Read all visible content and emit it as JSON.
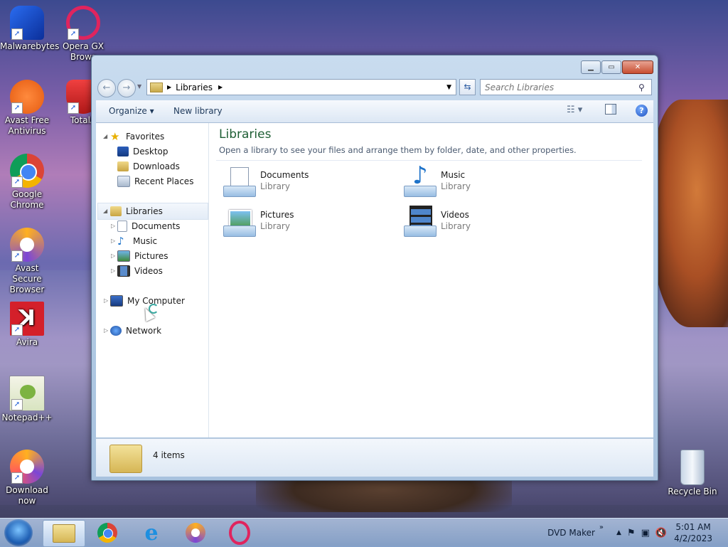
{
  "desktop": {
    "icons": [
      {
        "label": "Malwarebytes",
        "icon": "malwarebytes-icon",
        "color": "#1a56d6"
      },
      {
        "label": "Opera GX Brows",
        "icon": "opera-gx-icon",
        "color": "#e0245e"
      },
      {
        "label": "Avast Free Antivirus",
        "icon": "avast-icon",
        "color": "#f26b1d"
      },
      {
        "label": "TotalA",
        "icon": "totalav-icon",
        "color": "#d9262c"
      },
      {
        "label": "Google Chrome",
        "icon": "chrome-icon",
        "color": "#4285f4"
      },
      {
        "label": "Avast Secure Browser",
        "icon": "avast-browser-icon",
        "color": "#ffb020"
      },
      {
        "label": "Avira",
        "icon": "avira-icon",
        "color": "#d4202a"
      },
      {
        "label": "Notepad++",
        "icon": "notepadpp-icon",
        "color": "#8bc34a"
      },
      {
        "label": "Download now",
        "icon": "download-now-icon",
        "color": "#7b46d6"
      },
      {
        "label": "Recycle Bin",
        "icon": "recycle-bin-icon",
        "color": "#aab7c8"
      }
    ]
  },
  "window": {
    "address": {
      "crumb": "Libraries"
    },
    "search": {
      "placeholder": "Search Libraries"
    },
    "toolbar": {
      "organize": "Organize ▾",
      "new_library": "New library"
    },
    "nav": {
      "favorites": "Favorites",
      "desktop": "Desktop",
      "downloads": "Downloads",
      "recent": "Recent Places",
      "libraries": "Libraries",
      "documents": "Documents",
      "music": "Music",
      "pictures": "Pictures",
      "videos": "Videos",
      "my_computer": "My Computer",
      "network": "Network"
    },
    "content": {
      "title": "Libraries",
      "subtitle": "Open a library to see your files and arrange them by folder, date, and other properties.",
      "libraries": [
        {
          "name": "Documents",
          "type": "Library"
        },
        {
          "name": "Music",
          "type": "Library"
        },
        {
          "name": "Pictures",
          "type": "Library"
        },
        {
          "name": "Videos",
          "type": "Library"
        }
      ]
    },
    "status": {
      "count": "4 items"
    }
  },
  "taskbar": {
    "dvd_maker": "DVD Maker",
    "time": "5:01 AM",
    "date": "4/2/2023"
  }
}
